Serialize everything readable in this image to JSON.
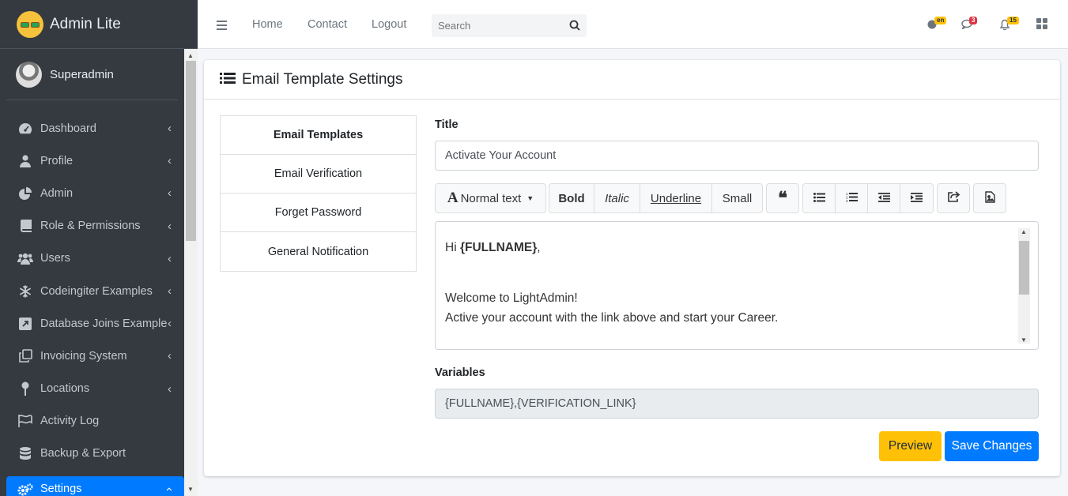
{
  "brand": {
    "name": "Admin Lite"
  },
  "user": {
    "name": "Superadmin"
  },
  "sidebar": {
    "items": [
      {
        "label": "Dashboard",
        "icon": "dashboard-icon"
      },
      {
        "label": "Profile",
        "icon": "user-icon"
      },
      {
        "label": "Admin",
        "icon": "pie-chart-icon"
      },
      {
        "label": "Role & Permissions",
        "icon": "book-icon"
      },
      {
        "label": "Users",
        "icon": "users-icon"
      },
      {
        "label": "Codeingiter Examples",
        "icon": "snowflake-icon"
      },
      {
        "label": "Database Joins Example",
        "icon": "external-link-icon"
      },
      {
        "label": "Invoicing System",
        "icon": "copy-icon"
      },
      {
        "label": "Locations",
        "icon": "map-pin-icon"
      },
      {
        "label": "Activity Log",
        "icon": "flag-icon"
      },
      {
        "label": "Backup & Export",
        "icon": "database-icon"
      },
      {
        "label": "Settings",
        "icon": "gears-icon"
      }
    ]
  },
  "topbar": {
    "nav": [
      "Home",
      "Contact",
      "Logout"
    ],
    "search_placeholder": "Search",
    "badges": {
      "language": "en",
      "messages": "3",
      "notifications": "15"
    }
  },
  "page": {
    "title": "Email Template Settings",
    "templates_header": "Email Templates",
    "templates": [
      "Email Verification",
      "Forget Password",
      "General Notification"
    ],
    "title_label": "Title",
    "title_value": "Activate Your Account",
    "toolbar": {
      "text_style": "Normal text",
      "bold": "Bold",
      "italic": "Italic",
      "underline": "Underline",
      "small": "Small"
    },
    "editor": {
      "greeting_prefix": "Hi ",
      "greeting_var": "{FULLNAME}",
      "greeting_suffix": ",",
      "line1": "Welcome to LightAdmin!",
      "line2": "Active your account with the link above and start your Career."
    },
    "variables_label": "Variables",
    "variables_value": "{FULLNAME},{VERIFICATION_LINK}",
    "preview_button": "Preview",
    "save_button": "Save Changes"
  },
  "colors": {
    "sidebar": "#343a40",
    "primary": "#007bff",
    "warning": "#ffc107",
    "danger": "#dc3545"
  }
}
